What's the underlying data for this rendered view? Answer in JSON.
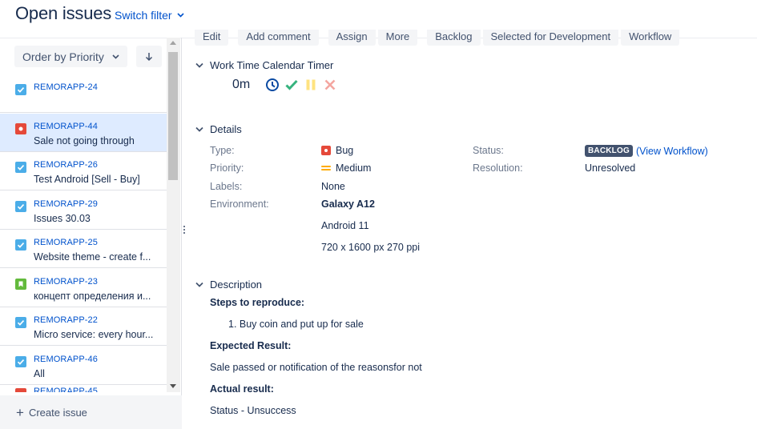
{
  "header": {
    "title": "Open issues",
    "switch_filter": "Switch filter"
  },
  "sidebar": {
    "order_label": "Order by Priority",
    "create_issue": "Create issue",
    "issues": [
      {
        "key": "REMORAPP-24",
        "summary": "",
        "type": "story-check"
      },
      {
        "key": "REMORAPP-44",
        "summary": "Sale not going through",
        "type": "bug"
      },
      {
        "key": "REMORAPP-26",
        "summary": "Test Android [Sell - Buy]",
        "type": "story-check"
      },
      {
        "key": "REMORAPP-29",
        "summary": "Issues 30.03",
        "type": "story-check"
      },
      {
        "key": "REMORAPP-25",
        "summary": "Website theme - create f...",
        "type": "story-check"
      },
      {
        "key": "REMORAPP-23",
        "summary": "концепт определения и...",
        "type": "story"
      },
      {
        "key": "REMORAPP-22",
        "summary": "Micro service: every hour...",
        "type": "story-check"
      },
      {
        "key": "REMORAPP-46",
        "summary": "All",
        "type": "story-check"
      },
      {
        "key": "REMORAPP-45",
        "summary": "",
        "type": "bug"
      }
    ]
  },
  "toolbar": {
    "buttons": [
      "Edit",
      "Add comment",
      "Assign",
      "More",
      "Backlog",
      "Selected for Development",
      "Workflow"
    ]
  },
  "timer": {
    "section_title": "Work Time Calendar Timer",
    "value": "0m"
  },
  "details": {
    "section_title": "Details",
    "type_label": "Type:",
    "type_value": "Bug",
    "priority_label": "Priority:",
    "priority_value": "Medium",
    "labels_label": "Labels:",
    "labels_value": "None",
    "environment_label": "Environment:",
    "environment_lines": [
      "Galaxy A12",
      "Android 11",
      "720 x 1600 px 270 ppi"
    ],
    "status_label": "Status:",
    "status_value": "BACKLOG",
    "view_workflow": "(View Workflow)",
    "resolution_label": "Resolution:",
    "resolution_value": "Unresolved"
  },
  "description": {
    "section_title": "Description",
    "steps_heading": "Steps to reproduce:",
    "step_1": "1. Buy coin and put up for sale",
    "expected_heading": "Expected Result:",
    "expected_text": "Sale passed or notification of the reasonsfor not",
    "actual_heading": "Actual result:",
    "actual_text": "Status - Unsuccess"
  },
  "colors": {
    "link": "#0052cc",
    "story_check": "#4bade8",
    "bug": "#e5493a",
    "story": "#63ba3c",
    "selected_row": "#deebff"
  }
}
